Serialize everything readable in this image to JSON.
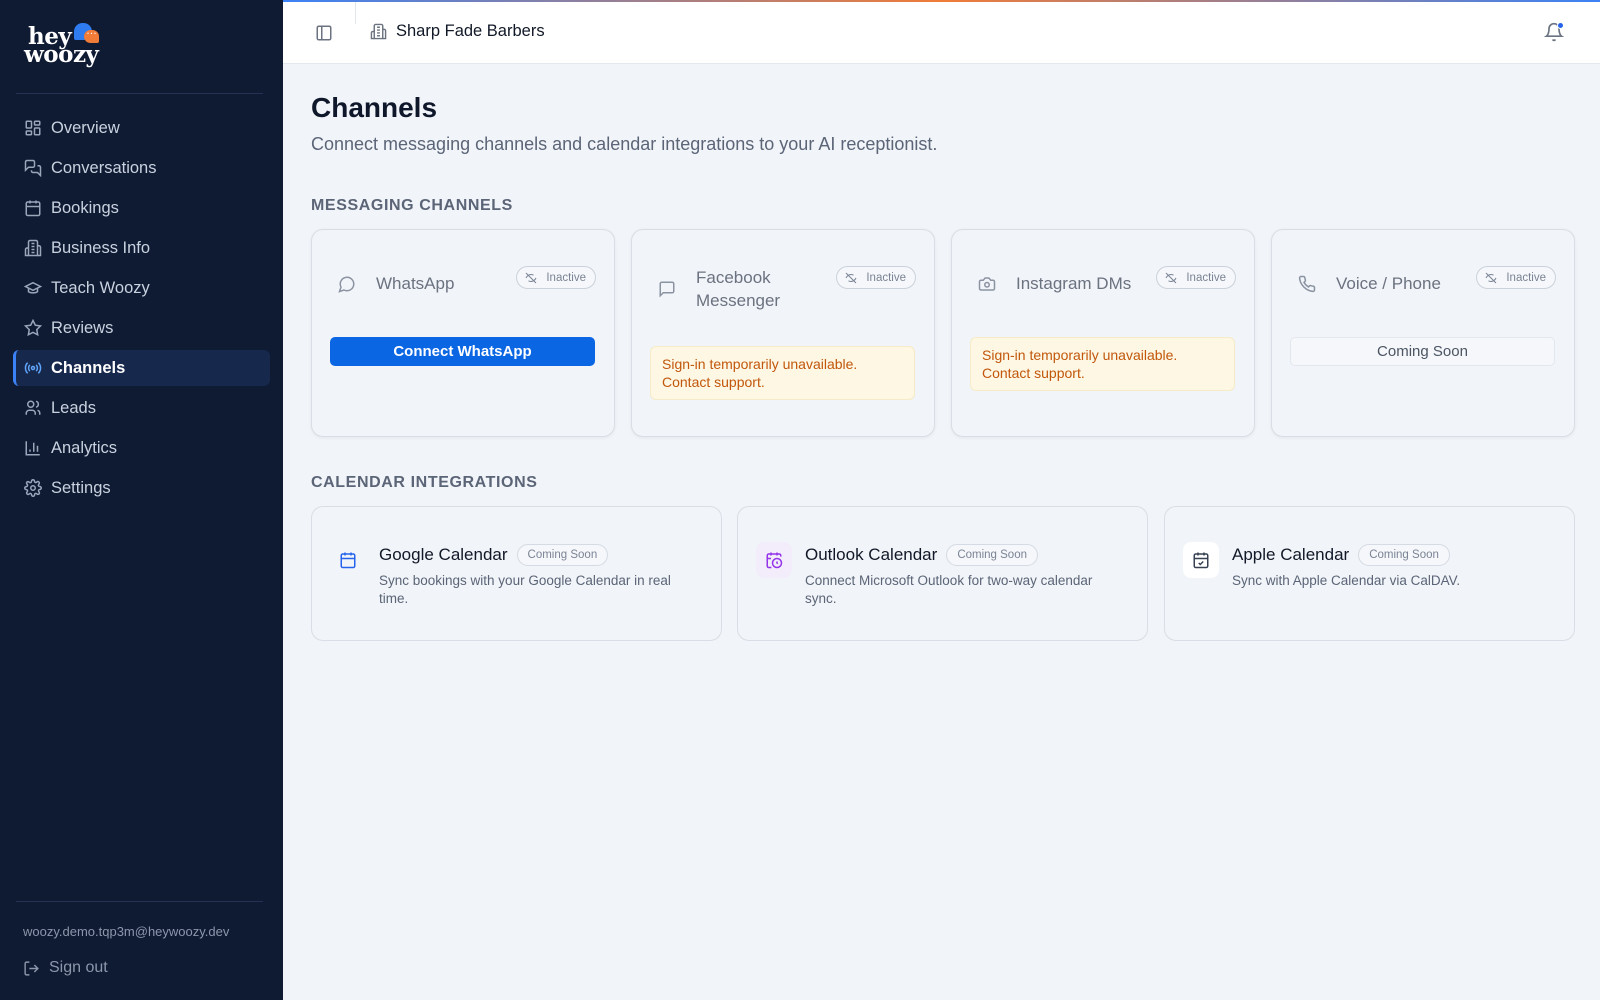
{
  "brand": {
    "line1": "hey",
    "line2": "woozy"
  },
  "sidebar": {
    "items": [
      {
        "label": "Overview",
        "icon": "dashboard-icon",
        "active": false
      },
      {
        "label": "Conversations",
        "icon": "chat-icon",
        "active": false
      },
      {
        "label": "Bookings",
        "icon": "calendar-icon",
        "active": false
      },
      {
        "label": "Business Info",
        "icon": "building-icon",
        "active": false
      },
      {
        "label": "Teach Woozy",
        "icon": "graduation-cap-icon",
        "active": false
      },
      {
        "label": "Reviews",
        "icon": "star-icon",
        "active": false
      },
      {
        "label": "Channels",
        "icon": "broadcast-icon",
        "active": true
      },
      {
        "label": "Leads",
        "icon": "users-icon",
        "active": false
      },
      {
        "label": "Analytics",
        "icon": "bar-chart-icon",
        "active": false
      },
      {
        "label": "Settings",
        "icon": "gear-icon",
        "active": false
      }
    ],
    "email": "woozy.demo.tqp3m@heywoozy.dev",
    "signout": "Sign out"
  },
  "header": {
    "business_name": "Sharp Fade Barbers"
  },
  "page": {
    "title": "Channels",
    "subtitle": "Connect messaging channels and calendar integrations to your AI receptionist."
  },
  "messaging": {
    "section_label": "MESSAGING CHANNELS",
    "channels": [
      {
        "name": "WhatsApp",
        "status": "Inactive",
        "action": "Connect WhatsApp"
      },
      {
        "name": "Facebook Messenger",
        "status": "Inactive",
        "notice": "Sign-in temporarily unavailable. Contact support."
      },
      {
        "name": "Instagram DMs",
        "status": "Inactive",
        "notice": "Sign-in temporarily unavailable. Contact support."
      },
      {
        "name": "Voice / Phone",
        "status": "Inactive",
        "action": "Coming Soon"
      }
    ]
  },
  "calendar": {
    "section_label": "CALENDAR INTEGRATIONS",
    "items": [
      {
        "name": "Google Calendar",
        "badge": "Coming Soon",
        "desc": "Sync bookings with your Google Calendar in real time.",
        "color": "#2563eb"
      },
      {
        "name": "Outlook Calendar",
        "badge": "Coming Soon",
        "desc": "Connect Microsoft Outlook for two-way calendar sync.",
        "color": "#9333ea"
      },
      {
        "name": "Apple Calendar",
        "badge": "Coming Soon",
        "desc": "Sync with Apple Calendar via CalDAV.",
        "color": "#374151"
      }
    ]
  },
  "colors": {
    "sidebar_bg": "#0f1a33",
    "primary": "#0b66e4",
    "warning_text": "#c2570c"
  }
}
